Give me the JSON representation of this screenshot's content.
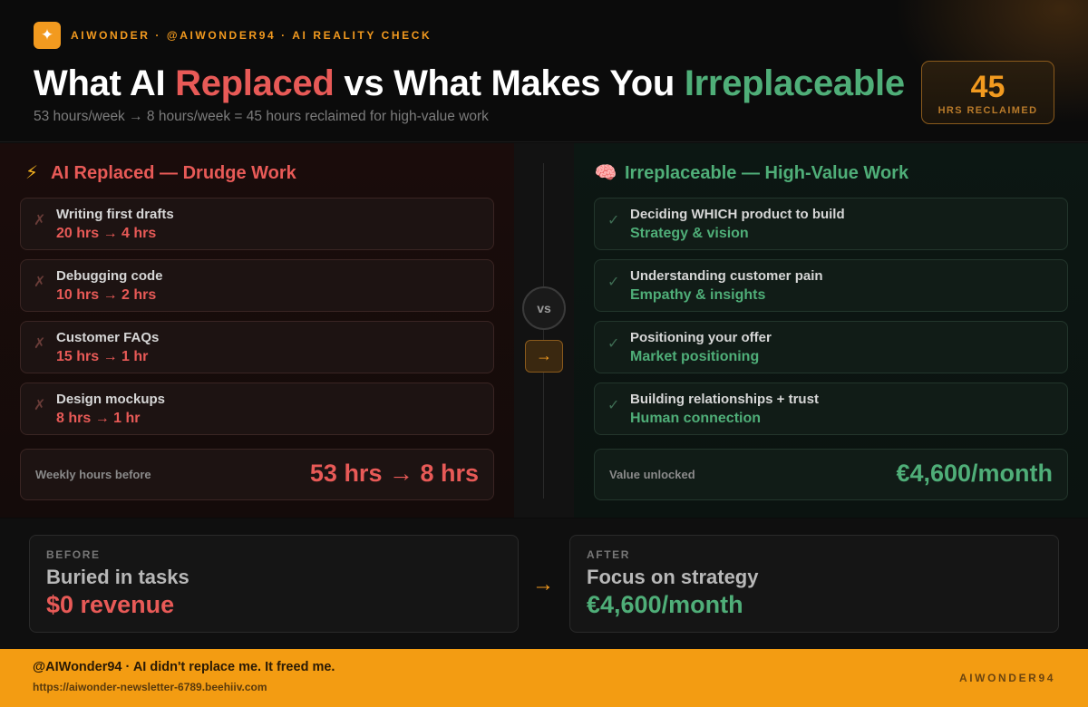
{
  "header": {
    "brand_line": "AIWONDER · @AIWONDER94 · AI REALITY CHECK",
    "title": {
      "part1": "What AI ",
      "part2": "Replaced",
      "part3": " vs What Makes You ",
      "part4": "Irreplaceable"
    },
    "subtitle": "53 hours/week → 8 hours/week = 45 hours reclaimed for high-value work",
    "stat": {
      "value": "45",
      "label": "HRS RECLAIMED"
    }
  },
  "left": {
    "heading": "AI Replaced — Drudge Work",
    "icon": "lightning-bolt-icon",
    "items": [
      {
        "name": "Writing first drafts",
        "detail": "20 hrs → 4 hrs"
      },
      {
        "name": "Debugging code",
        "detail": "10 hrs → 2 hrs"
      },
      {
        "name": "Customer FAQs",
        "detail": "15 hrs → 1 hr"
      },
      {
        "name": "Design mockups",
        "detail": "8 hrs → 1 hr"
      }
    ],
    "summary": {
      "label": "Weekly hours before",
      "value": "53 hrs → 8 hrs"
    }
  },
  "middle": {
    "vs": "vs",
    "arrow": "→"
  },
  "right": {
    "heading": "Irreplaceable — High-Value Work",
    "icon": "brain-icon",
    "items": [
      {
        "name": "Deciding WHICH product to build",
        "detail": "Strategy & vision"
      },
      {
        "name": "Understanding customer pain",
        "detail": "Empathy & insights"
      },
      {
        "name": "Positioning your offer",
        "detail": "Market positioning"
      },
      {
        "name": "Building relationships + trust",
        "detail": "Human connection"
      }
    ],
    "summary": {
      "label": "Value unlocked",
      "value": "€4,600/month"
    }
  },
  "before_after": {
    "before": {
      "tag": "BEFORE",
      "heading": "Buried in tasks",
      "value": "$0 revenue"
    },
    "arrow": "→",
    "after": {
      "tag": "AFTER",
      "heading": "Focus on strategy",
      "value": "€4,600/month"
    }
  },
  "footer": {
    "main": "@AIWonder94 · AI didn't replace me. It freed me.",
    "url": "https://aiwonder-newsletter-6789.beehiiv.com",
    "brand": "AIWONDER94"
  },
  "colors": {
    "accent": "#f29a1f",
    "replaced_red": "#e85a57",
    "irreplaceable_green": "#4fae78",
    "footer_bg": "#f39c12"
  }
}
